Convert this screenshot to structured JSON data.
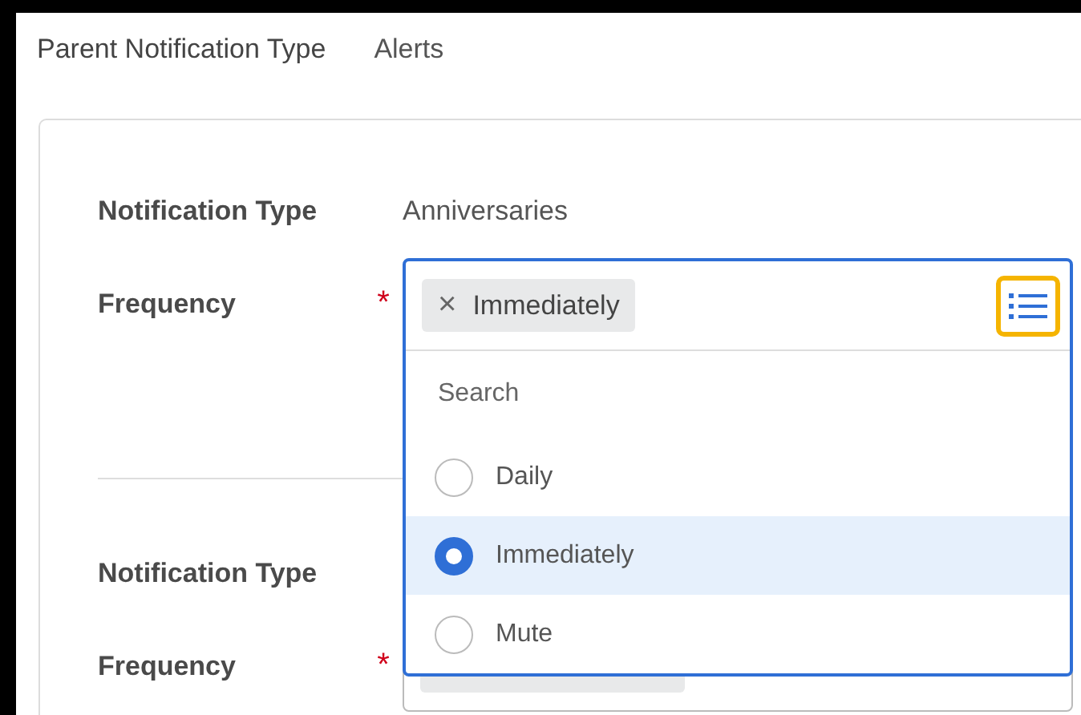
{
  "parent": {
    "label": "Parent Notification Type",
    "value": "Alerts"
  },
  "groups": [
    {
      "type_label": "Notification Type",
      "type_value": "Anniversaries",
      "frequency_label": "Frequency",
      "required_mark": "*",
      "expanded": true,
      "chip_remove": "×",
      "chip": "Immediately",
      "search": {
        "placeholder": "Search"
      },
      "options": [
        {
          "label": "Daily",
          "selected": false
        },
        {
          "label": "Immediately",
          "selected": true
        },
        {
          "label": "Mute",
          "selected": false
        }
      ]
    },
    {
      "type_label": "Notification Type",
      "frequency_label": "Frequency",
      "required_mark": "*",
      "expanded": false
    }
  ]
}
